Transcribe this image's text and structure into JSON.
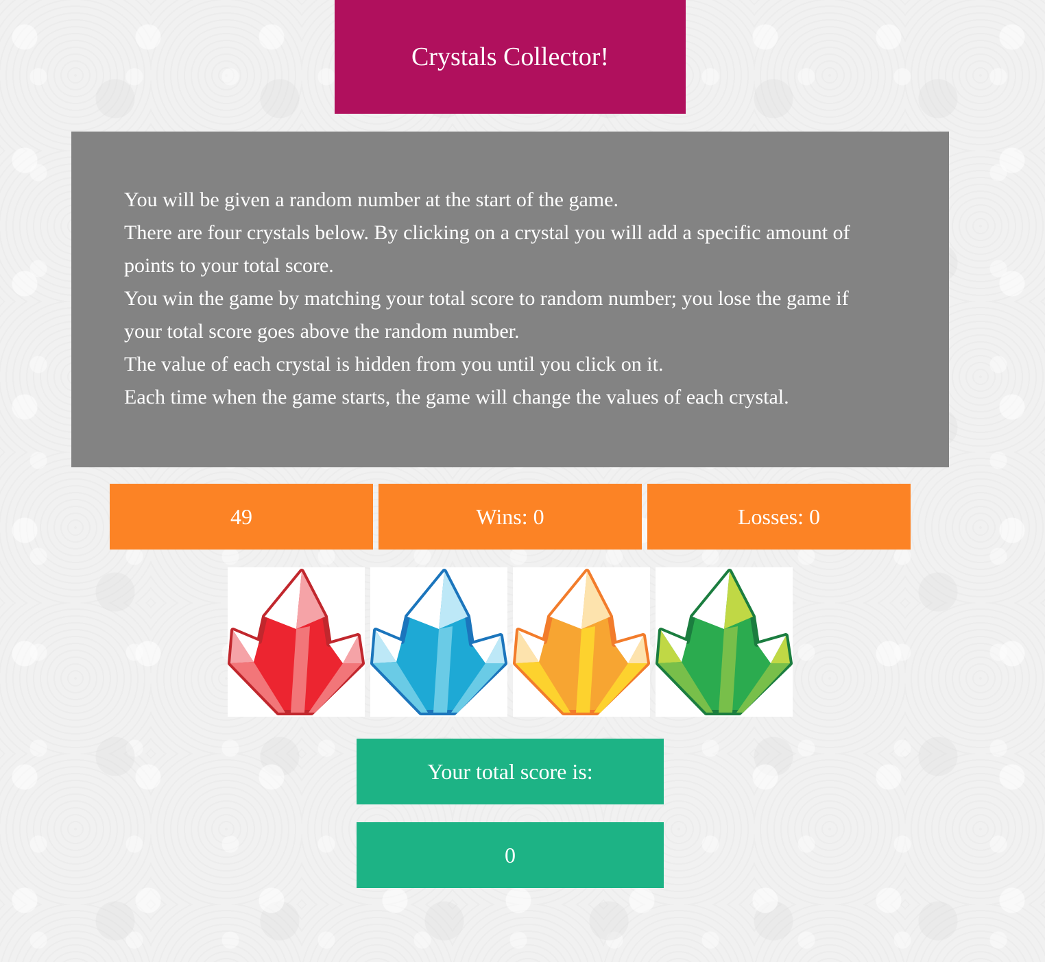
{
  "header": {
    "title": "Crystals Collector!"
  },
  "instructions": {
    "lines": [
      "You will be given a random number at the start of the game.",
      "There are four crystals below. By clicking on a crystal you will add a specific amount of points to your total score.",
      "You win the game by matching your total score to random number; you lose the game if your total score goes above the random number.",
      "The value of each crystal is hidden from you until you click on it.",
      "Each time when the game starts, the game will change the values of each crystal."
    ]
  },
  "stats": {
    "target_number": "49",
    "wins": "Wins: 0",
    "losses": "Losses: 0"
  },
  "crystals": [
    {
      "name": "red-crystal-icon",
      "color": "#ec2530",
      "outline": "#c1272d"
    },
    {
      "name": "blue-crystal-icon",
      "color": "#1ea9d5",
      "outline": "#1b75bc"
    },
    {
      "name": "orange-crystal-icon",
      "color": "#f7a532",
      "outline": "#f27c2b"
    },
    {
      "name": "green-crystal-icon",
      "color": "#2bab4f",
      "outline": "#1b7d3f"
    }
  ],
  "score": {
    "label": "Your total score is:",
    "value": "0"
  },
  "colors": {
    "title_bg": "#b0105d",
    "instructions_bg": "#838383",
    "stats_bg": "#fc8325",
    "score_bg": "#1db385",
    "text": "#ffffff"
  }
}
